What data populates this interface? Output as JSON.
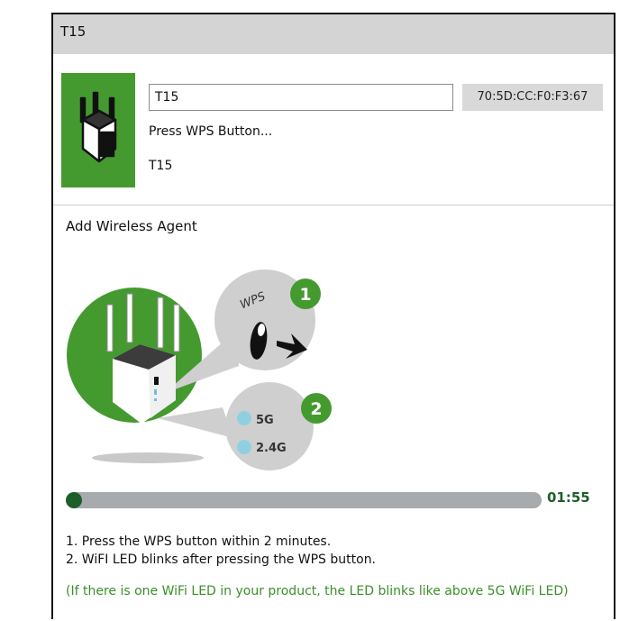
{
  "window": {
    "title": "T15"
  },
  "device": {
    "name_value": "T15",
    "mac": "70:5D:CC:F0:F3:67",
    "status": "Press WPS Button...",
    "subname": "T15",
    "thumb_color": "#449a2f"
  },
  "wizard": {
    "title": "Add Wireless Agent",
    "illustration": {
      "wps_label": "WPS",
      "step1": "1",
      "step2": "2",
      "led_5g": "5G",
      "led_24g": "2.4G"
    },
    "progress": {
      "fraction": 0.035,
      "timer": "01:55"
    },
    "instructions": [
      "1. Press the WPS button within 2 minutes.",
      "2. WiFI LED blinks after pressing the WPS button."
    ],
    "note": "(If there is one WiFi LED in your product, the LED blinks like above 5G WiFi LED)"
  },
  "colors": {
    "green": "#449a2f",
    "dark_green": "#1d5f2a",
    "bubble": "#cfcfcf",
    "led": "#8fd0e0"
  }
}
